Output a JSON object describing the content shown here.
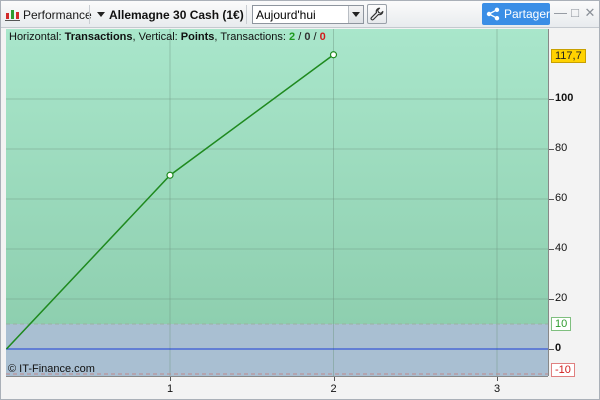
{
  "toolbar": {
    "performance_label": "Performance",
    "instrument_label": "Allemagne 30 Cash (1€)",
    "period_value": "Aujourd'hui",
    "share_label": "Partager",
    "minimize_label": "—",
    "restore_label": "□",
    "close_label": "✕"
  },
  "info": {
    "horizontal_prefix": "Horizontal: ",
    "horizontal_value": "Transactions",
    "vertical_prefix": ", Vertical: ",
    "vertical_value": "Points",
    "transactions_prefix": ", Transactions: ",
    "winning": "2",
    "neutral": "0",
    "losing": "0",
    "sep": " / "
  },
  "copyright": "© IT-Finance.com",
  "yaxis": {
    "labels": [
      "100",
      "80",
      "60",
      "40",
      "20",
      "0"
    ],
    "last_value_badge": "117,7",
    "positive_threshold_badge": "10",
    "negative_threshold_badge": "-10"
  },
  "xaxis": {
    "labels": [
      "1",
      "2",
      "3"
    ]
  },
  "colors": {
    "line": "#1f8a1f",
    "green_zone": "#a9e6cb",
    "blue_zone": "#a9bfd2",
    "zero_line": "#1a3cd6",
    "share_button": "#3a8ee6"
  },
  "chart_data": {
    "type": "line",
    "x": [
      0,
      1,
      2
    ],
    "y": [
      0,
      69.5,
      117.7
    ],
    "xlabel": "",
    "ylabel": "",
    "xlim": [
      0,
      3.3
    ],
    "ylim": [
      -10,
      130
    ],
    "thresholds": {
      "positive": 10,
      "negative": -10
    },
    "grid": true
  }
}
